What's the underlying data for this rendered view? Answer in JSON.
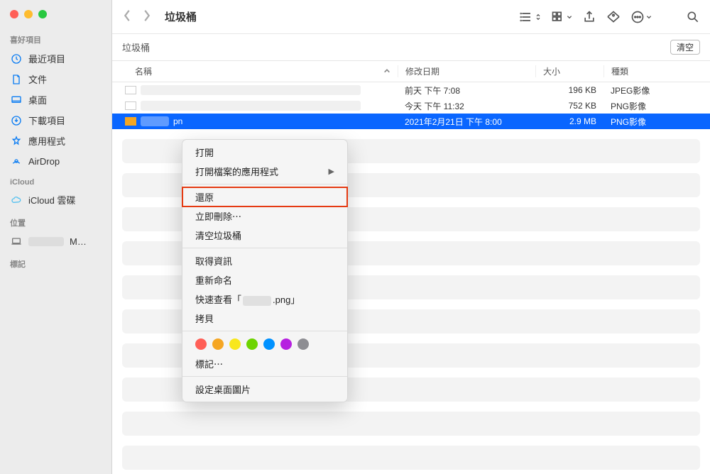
{
  "window": {
    "title": "垃圾桶"
  },
  "sidebar": {
    "section_favorites": "喜好項目",
    "section_icloud": "iCloud",
    "section_locations": "位置",
    "section_tags": "標記",
    "items": {
      "recents": "最近項目",
      "documents": "文件",
      "desktop": "桌面",
      "downloads": "下載項目",
      "applications": "應用程式",
      "airdrop": "AirDrop",
      "icloud_drive": "iCloud 雲碟",
      "mac": "M…"
    }
  },
  "pathbar": {
    "location": "垃圾桶",
    "empty_button": "清空"
  },
  "columns": {
    "name": "名稱",
    "date": "修改日期",
    "size": "大小",
    "kind": "種類"
  },
  "files": [
    {
      "date": "前天 下午 7:08",
      "size": "196 KB",
      "kind": "JPEG影像"
    },
    {
      "date": "今天 下午 11:32",
      "size": "752 KB",
      "kind": "PNG影像"
    },
    {
      "name_suffix": "pn",
      "date": "2021年2月21日 下午 8:00",
      "size": "2.9 MB",
      "kind": "PNG影像"
    }
  ],
  "context_menu": {
    "open": "打開",
    "open_with": "打開檔案的應用程式",
    "put_back": "還原",
    "delete_now": "立即刪除⋯",
    "empty_trash": "清空垃圾桶",
    "get_info": "取得資訊",
    "rename": "重新命名",
    "quick_look_prefix": "快速查看「",
    "quick_look_suffix": ".png」",
    "copy": "拷貝",
    "tags_label": "標記⋯",
    "set_desktop": "設定桌面圖片"
  },
  "tag_colors": [
    "#ff5f57",
    "#f5a623",
    "#f8e71c",
    "#6dd400",
    "#0091ff",
    "#b620e0",
    "#8e8e93"
  ]
}
